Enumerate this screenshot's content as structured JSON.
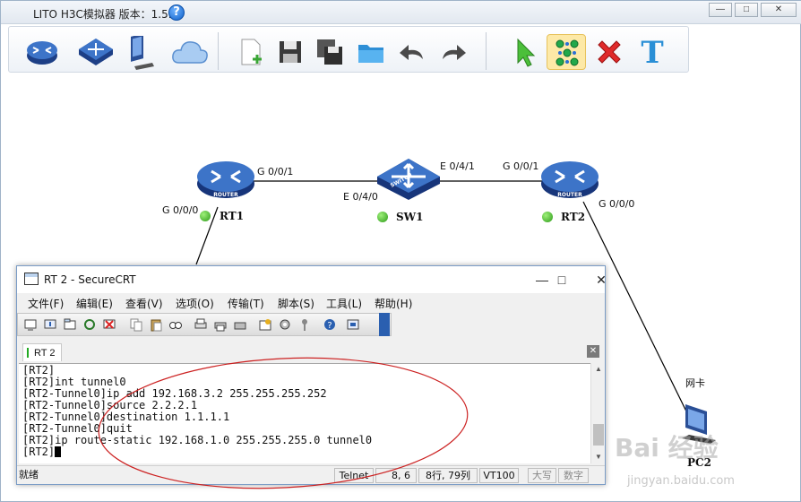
{
  "app": {
    "title": "LITO H3C模拟器 版本：1.5.2",
    "help_icon": "help-circle-icon",
    "window_controls": [
      "minimize",
      "maximize",
      "close"
    ]
  },
  "toolbar": {
    "items": [
      {
        "name": "router-tool",
        "icon": "router-icon",
        "label": "ROUTER"
      },
      {
        "name": "switch-tool",
        "icon": "switch-icon",
        "label": "SWITCH"
      },
      {
        "name": "pc-tool",
        "icon": "pc-icon"
      },
      {
        "name": "cloud-tool",
        "icon": "cloud-icon"
      },
      {
        "name": "new-file-tool",
        "icon": "new-file-icon"
      },
      {
        "name": "save-tool",
        "icon": "save-icon"
      },
      {
        "name": "save-as-tool",
        "icon": "save-as-icon"
      },
      {
        "name": "open-folder-tool",
        "icon": "folder-icon"
      },
      {
        "name": "undo-tool",
        "icon": "undo-icon"
      },
      {
        "name": "redo-tool",
        "icon": "redo-icon"
      },
      {
        "name": "select-tool",
        "icon": "pointer-icon"
      },
      {
        "name": "connect-tool",
        "icon": "connect-dots-icon",
        "active": true
      },
      {
        "name": "delete-tool",
        "icon": "delete-x-icon"
      },
      {
        "name": "text-tool",
        "icon": "text-icon",
        "label": "T"
      }
    ]
  },
  "topology": {
    "devices": [
      {
        "id": "rt1",
        "name": "RT1",
        "type": "router",
        "icon_label": "ROUTER",
        "status": "up"
      },
      {
        "id": "sw1",
        "name": "SW1",
        "type": "switch",
        "icon_label": "SWITCH",
        "status": "up"
      },
      {
        "id": "rt2",
        "name": "RT2",
        "type": "router",
        "icon_label": "ROUTER",
        "status": "up"
      },
      {
        "id": "pc2",
        "name": "PC2",
        "type": "pc",
        "nic_label": "网卡"
      }
    ],
    "ports": {
      "rt1_g001": "G 0/0/1",
      "rt1_g000": "G 0/0/0",
      "sw1_e040": "E 0/4/0",
      "sw1_e041": "E 0/4/1",
      "rt2_g001": "G 0/0/1",
      "rt2_g000": "G 0/0/0"
    },
    "status_color": "#2c9a18"
  },
  "crt": {
    "title": "RT 2 - SecureCRT",
    "menu": [
      "文件(F)",
      "编辑(E)",
      "查看(V)",
      "选项(O)",
      "传输(T)",
      "脚本(S)",
      "工具(L)",
      "帮助(H)"
    ],
    "tab": "RT 2",
    "terminal_lines": [
      "[RT2]",
      "[RT2]int tunnel0",
      "[RT2-Tunnel0]ip add 192.168.3.2 255.255.255.252",
      "[RT2-Tunnel0]source 2.2.2.1",
      "[RT2-Tunnel0]destination 1.1.1.1",
      "[RT2-Tunnel0]quit",
      "[RT2]ip route-static 192.168.1.0 255.255.255.0 tunnel0",
      "[RT2]"
    ],
    "status": {
      "ready": "就绪",
      "protocol": "Telnet",
      "cursor_pos": "8,  6",
      "rowcol": "8行, 79列",
      "emulation": "VT100",
      "caps": "大写",
      "num": "数字"
    }
  },
  "annotation": {
    "color": "#cc2222"
  },
  "watermark": {
    "text": "Bai 经验",
    "sub": "jingyan.baidu.com"
  }
}
